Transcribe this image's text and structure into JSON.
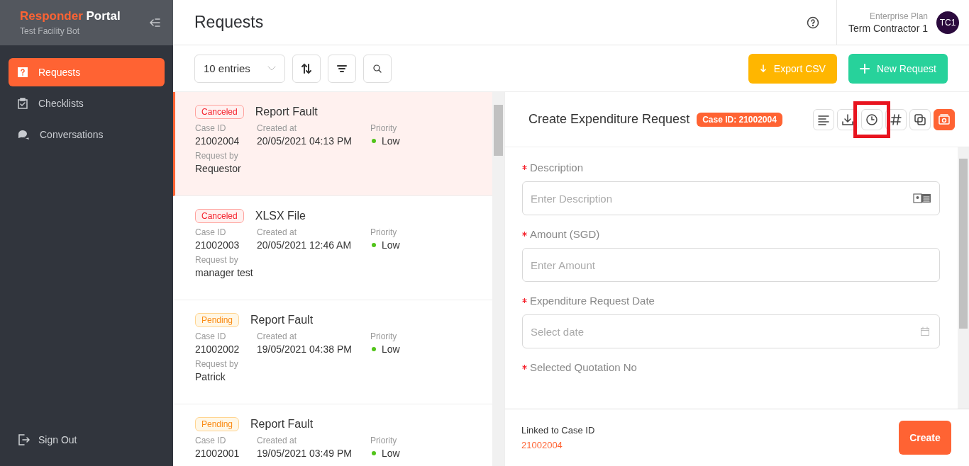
{
  "sidebar": {
    "brand_first": "Responder",
    "brand_second": "Portal",
    "subtitle": "Test Facility Bot",
    "items": [
      {
        "label": "Requests",
        "selected": true
      },
      {
        "label": "Checklists",
        "selected": false
      },
      {
        "label": "Conversations",
        "selected": false
      }
    ],
    "sign_out": "Sign Out"
  },
  "header": {
    "title": "Requests",
    "plan": "Enterprise Plan",
    "user": "Term Contractor 1",
    "avatar": "TC1"
  },
  "toolbar": {
    "entries": "10 entries",
    "export": "Export CSV",
    "new_request": "New Request"
  },
  "requests": [
    {
      "status": "Canceled",
      "title": "Report Fault",
      "case_label": "Case ID",
      "case_id": "21002004",
      "created_label": "Created at",
      "created": "20/05/2021 04:13 PM",
      "priority_label": "Priority",
      "priority": "Low",
      "by_label": "Request by",
      "by": "Requestor",
      "selected": true
    },
    {
      "status": "Canceled",
      "title": "XLSX File",
      "case_label": "Case ID",
      "case_id": "21002003",
      "created_label": "Created at",
      "created": "20/05/2021 12:46 AM",
      "priority_label": "Priority",
      "priority": "Low",
      "by_label": "Request by",
      "by": "manager test",
      "selected": false
    },
    {
      "status": "Pending",
      "title": "Report Fault",
      "case_label": "Case ID",
      "case_id": "21002002",
      "created_label": "Created at",
      "created": "19/05/2021 04:38 PM",
      "priority_label": "Priority",
      "priority": "Low",
      "by_label": "Request by",
      "by": "Patrick",
      "selected": false
    },
    {
      "status": "Pending",
      "title": "Report Fault",
      "case_label": "Case ID",
      "case_id": "21002001",
      "created_label": "Created at",
      "created": "19/05/2021 03:49 PM",
      "priority_label": "Priority",
      "priority": "Low",
      "selected": false
    }
  ],
  "detail": {
    "title": "Create Expenditure Request",
    "case_badge": "Case ID: 21002004",
    "tools": [
      {
        "selected": false,
        "highlighted": false
      },
      {
        "selected": false,
        "highlighted": false
      },
      {
        "selected": false,
        "highlighted": true
      },
      {
        "selected": false,
        "highlighted": false
      },
      {
        "selected": false,
        "highlighted": false
      },
      {
        "selected": true,
        "highlighted": false
      }
    ],
    "fields": [
      {
        "label": "Description",
        "placeholder": "Enter Description",
        "kind": "text-card",
        "required": true
      },
      {
        "label": "Amount (SGD)",
        "placeholder": "Enter Amount",
        "kind": "text",
        "required": true
      },
      {
        "label": "Expenditure Request Date",
        "placeholder": "Select date",
        "kind": "date",
        "required": true
      },
      {
        "label": "Selected Quotation No",
        "kind": "label",
        "required": true
      }
    ],
    "linked_label": "Linked to Case ID",
    "linked_id": "21002004",
    "create": "Create"
  }
}
